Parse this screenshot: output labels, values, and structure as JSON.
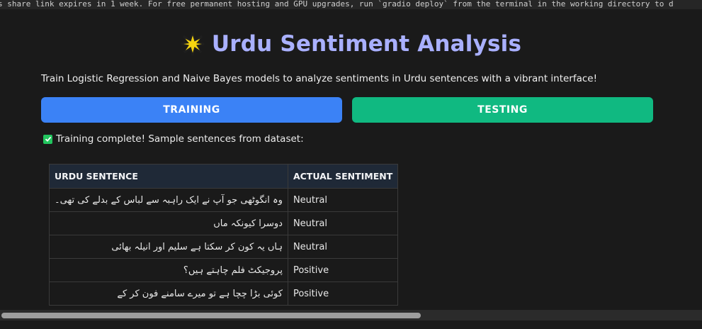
{
  "notice": {
    "text": "s share link expires in 1 week. For free permanent hosting and GPU upgrades, run `gradio deploy` from the terminal in the working directory to d"
  },
  "header": {
    "title": "Urdu Sentiment Analysis",
    "title_icon": "star-icon",
    "subtitle": "Train Logistic Regression and Naive Bayes models to analyze sentiments in Urdu sentences with a vibrant interface!"
  },
  "buttons": {
    "training_label": "TRAINING",
    "testing_label": "TESTING"
  },
  "status": {
    "icon": "check-icon",
    "text": "Training complete! Sample sentences from dataset:"
  },
  "table": {
    "headers": [
      "URDU SENTENCE",
      "ACTUAL SENTIMENT"
    ],
    "rows": [
      {
        "sentence": "وہ انگوٹھی جو آپ نے ایک راہبہ سے لباس کے بدلے کی تھی۔",
        "sentiment": "Neutral"
      },
      {
        "sentence": "دوسرا کیونکہ ماں",
        "sentiment": "Neutral"
      },
      {
        "sentence": "ہاں یہ کون کر سکتا ہے سلیم اور انیلہ بھائی",
        "sentiment": "Neutral"
      },
      {
        "sentence": "پروجیکٹ فلم چاہتے ہیں؟",
        "sentiment": "Positive"
      },
      {
        "sentence": "کوئی بڑا چچا ہے تو میرے سامنے فون کر کے",
        "sentiment": "Positive"
      }
    ]
  },
  "colors": {
    "title": "#a9b0ff",
    "training_button": "#3b82f6",
    "testing_button": "#10b981",
    "background": "#1a1a1a"
  }
}
